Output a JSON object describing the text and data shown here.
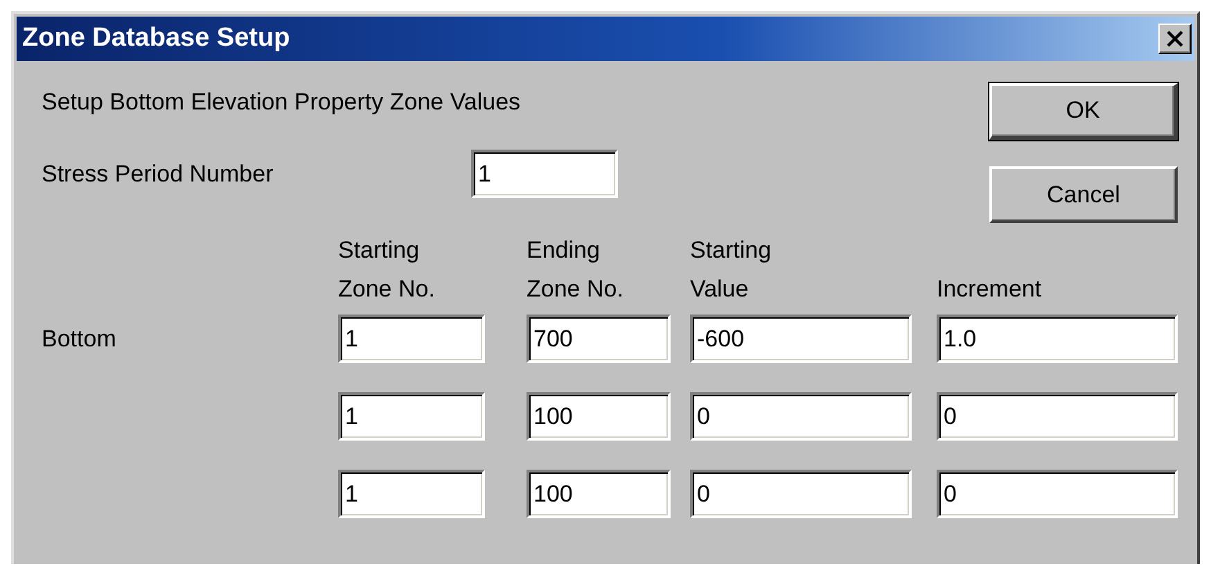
{
  "window": {
    "title": "Zone Database Setup"
  },
  "description": "Setup Bottom Elevation Property Zone Values",
  "stress_period": {
    "label": "Stress Period Number",
    "value": "1"
  },
  "buttons": [
    {
      "label": "OK",
      "default": true
    },
    {
      "label": "Cancel",
      "default": false
    }
  ],
  "columns": [
    "Starting\nZone No.",
    "Ending\nZone No.",
    "Starting\nValue",
    "Increment"
  ],
  "rows": [
    {
      "label": "Bottom",
      "values": [
        "1",
        "700",
        "-600",
        "1.0"
      ]
    },
    {
      "values": [
        "1",
        "100",
        "0",
        "0"
      ]
    },
    {
      "values": [
        "1",
        "100",
        "0",
        "0"
      ]
    }
  ]
}
